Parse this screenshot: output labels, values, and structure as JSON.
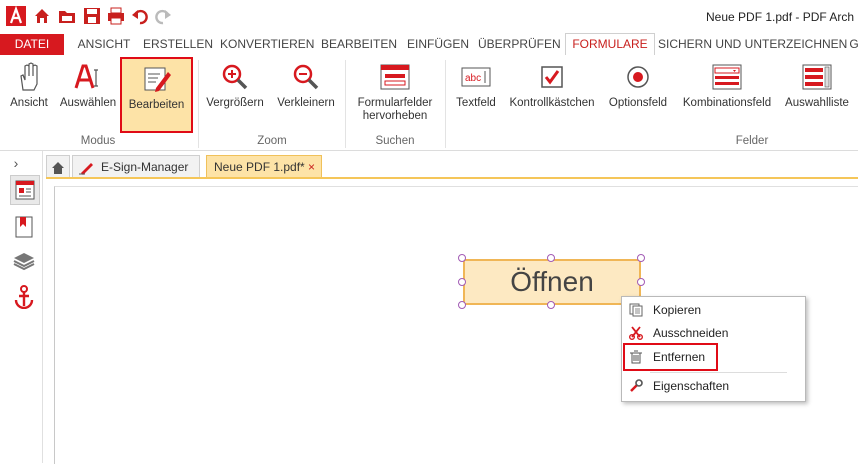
{
  "window": {
    "title": "Neue PDF 1.pdf   -   PDF Arch"
  },
  "menu": {
    "tabs": [
      "DATEI",
      "ANSICHT",
      "ERSTELLEN",
      "KONVERTIEREN",
      "BEARBEITEN",
      "EINFÜGEN",
      "ÜBERPRÜFEN",
      "FORMULARE",
      "SICHERN UND UNTERZEICHNEN",
      "G"
    ],
    "active": "FORMULARE"
  },
  "ribbon": {
    "buttons": {
      "ansicht": "Ansicht",
      "auswaehlen": "Auswählen",
      "bearbeiten": "Bearbeiten",
      "vergroessern": "Vergrößern",
      "verkleinern": "Verkleinern",
      "formularfelder": "Formularfelder\nhervorheben",
      "textfeld": "Textfeld",
      "kontrollkaestchen": "Kontrollkästchen",
      "optionsfeld": "Optionsfeld",
      "kombinationsfeld": "Kombinationsfeld",
      "auswahlliste": "Auswahlliste"
    },
    "groups": {
      "modus": "Modus",
      "zoom": "Zoom",
      "suchen": "Suchen",
      "felder": "Felder"
    }
  },
  "doc_tabs": {
    "esign": "E-Sign-Manager",
    "pdf": "Neue PDF 1.pdf*",
    "close": "×"
  },
  "form_field": {
    "text": "Öffnen"
  },
  "context_menu": {
    "kopieren": "Kopieren",
    "ausschneiden": "Ausschneiden",
    "entfernen": "Entfernen",
    "eigenschaften": "Eigenschaften"
  },
  "colors": {
    "accent": "#d7191f",
    "highlight": "#fde3a7",
    "tab_underline": "#f5c659"
  }
}
